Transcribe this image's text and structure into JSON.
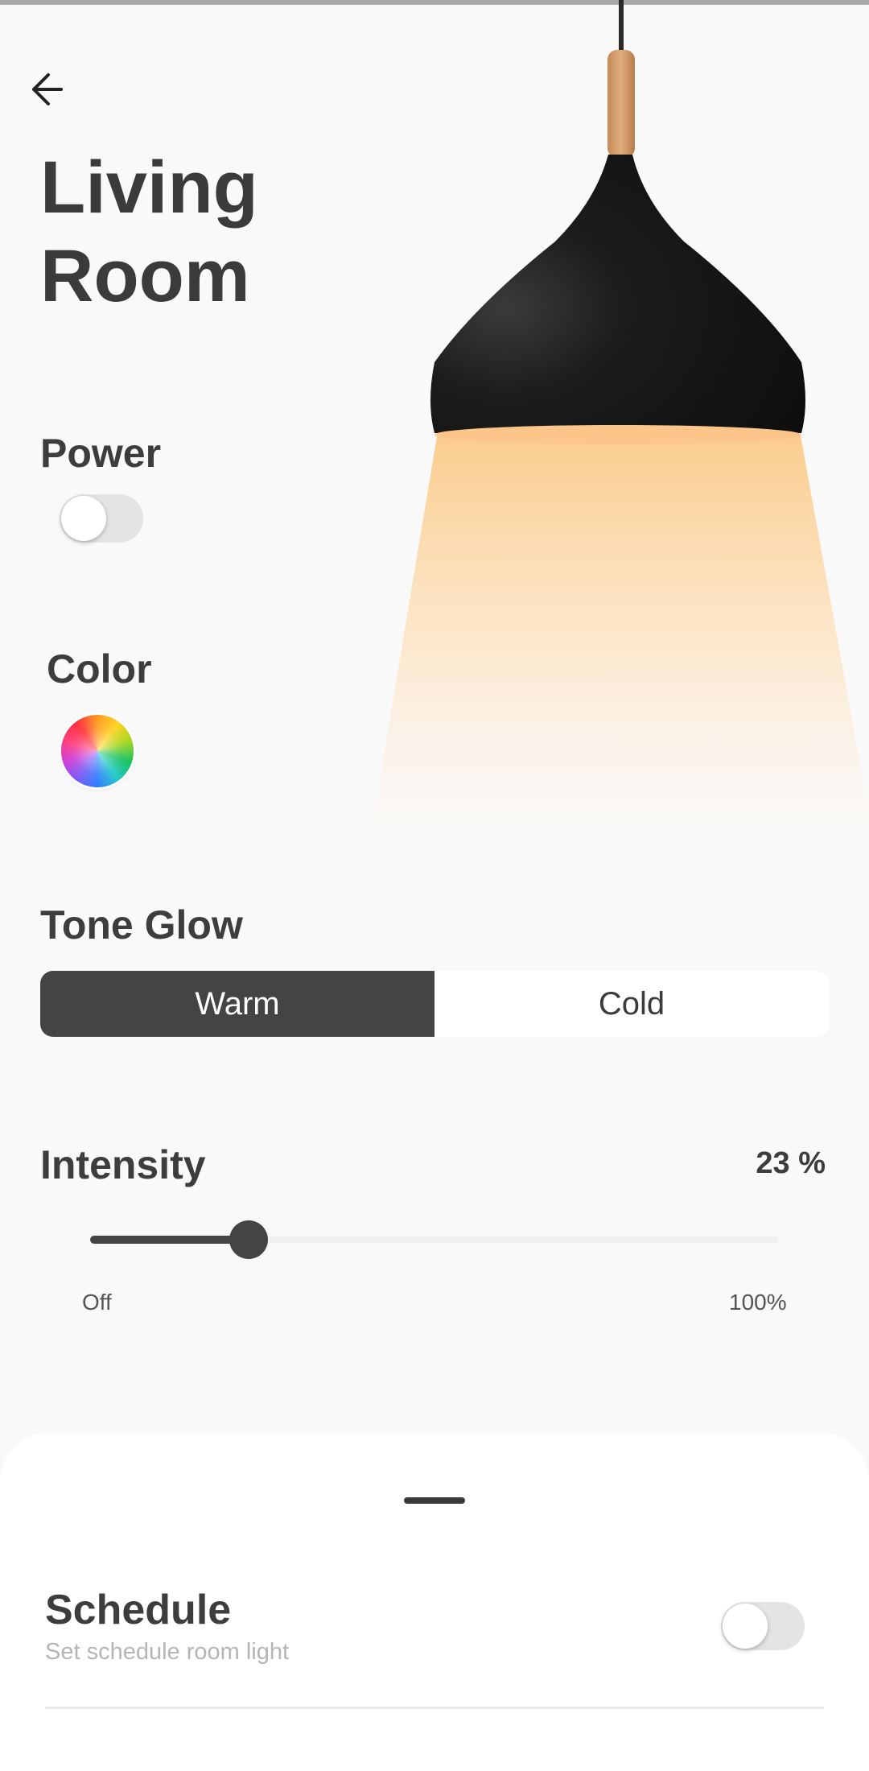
{
  "header": {
    "title_line1": "Living",
    "title_line2": "Room"
  },
  "power": {
    "label": "Power",
    "on": false
  },
  "color": {
    "label": "Color"
  },
  "tone_glow": {
    "label": "Tone Glow",
    "options": [
      "Warm",
      "Cold"
    ],
    "selected": "Warm"
  },
  "intensity": {
    "label": "Intensity",
    "value_text": "23 %",
    "value": 23,
    "min_label": "Off",
    "max_label": "100%"
  },
  "schedule": {
    "title": "Schedule",
    "subtitle": "Set schedule room light",
    "on": false
  },
  "icons": {
    "back": "arrow-left-icon",
    "color": "color-wheel-icon"
  },
  "colors": {
    "background": "#f9f9f9",
    "dark": "#444444",
    "light_glow": "#fbd49b"
  }
}
